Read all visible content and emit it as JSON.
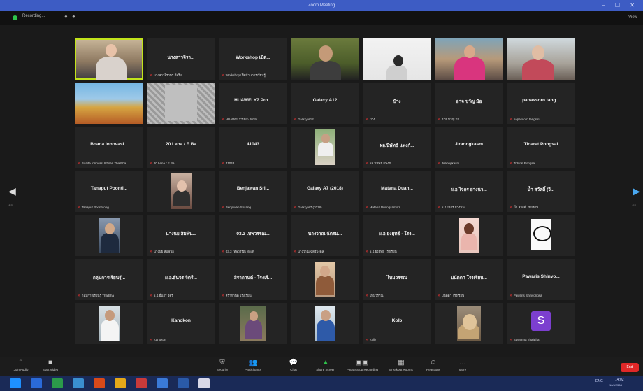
{
  "window": {
    "title": "Zoom Meeting",
    "controls": "–  ☐  ✕"
  },
  "topbar": {
    "recording_label": "Recording...",
    "dots": "● ●",
    "view_label": "View"
  },
  "nav": {
    "left_arrow": "◀",
    "right_arrow": "▶",
    "left_page": "1/3",
    "right_page": "1/3"
  },
  "tiles": [
    {
      "type": "photo",
      "name": "",
      "label": "",
      "scene": "woman-desk",
      "active": true
    },
    {
      "type": "name",
      "name": "นางสาวจิรา...",
      "label": "นางสาวจิราพร ดีจริง"
    },
    {
      "type": "name",
      "name": "Workshop เปิด...",
      "label": "Workshop เปิดบ้านการเรียนรู้"
    },
    {
      "type": "photo",
      "name": "",
      "label": "",
      "scene": "boy-green"
    },
    {
      "type": "photo",
      "name": "",
      "label": "",
      "scene": "boy-white"
    },
    {
      "type": "photo",
      "name": "",
      "label": "",
      "scene": "girl-pink"
    },
    {
      "type": "photo",
      "name": "",
      "label": "",
      "scene": "woman-room"
    },
    {
      "type": "photo",
      "name": "",
      "label": "",
      "scene": "temple"
    },
    {
      "type": "photo",
      "name": "",
      "label": "",
      "scene": "gray-pattern"
    },
    {
      "type": "name",
      "name": "HUAWEI Y7 Pro...",
      "label": "HUAWEI Y7 Pro 2019"
    },
    {
      "type": "name",
      "name": "Galaxy A12",
      "label": "Galaxy A12"
    },
    {
      "type": "name",
      "name": "ป้าง",
      "label": "ป้าง"
    },
    {
      "type": "name",
      "name": "อาจ ขวัญ ม้อ",
      "label": "อาจ ขวัญ ม้อ"
    },
    {
      "type": "name",
      "name": "papassorn tang...",
      "label": "papassorn tangsiri"
    },
    {
      "type": "name",
      "name": "Boada Innovasi...",
      "label": "Boada Innovasi Ikhsan ThaiBha"
    },
    {
      "type": "name",
      "name": "20 Lena / E.Ba",
      "label": "20 Lena / E.Ba"
    },
    {
      "type": "name",
      "name": "41043",
      "label": "41043"
    },
    {
      "type": "photo",
      "name": "",
      "label": "",
      "scene": "person-outdoor"
    },
    {
      "type": "name",
      "name": "ผอ.นิพัทธ์ แพงก์...",
      "label": "ผอ.นิพัทธ์ แพงก์"
    },
    {
      "type": "name",
      "name": "Jiraongkasm",
      "label": "Jiraongkasm"
    },
    {
      "type": "name",
      "name": "Tidarat Pongsai",
      "label": "Tidarat Pongsai"
    },
    {
      "type": "name",
      "name": "Tanaput Poonti...",
      "label": "Tanaput Poontirong"
    },
    {
      "type": "photo",
      "name": "",
      "label": "",
      "scene": "woman-portrait"
    },
    {
      "type": "name",
      "name": "Benjawan Sri...",
      "label": "Benjawan Srisang"
    },
    {
      "type": "name",
      "name": "Galaxy A7 (2018)",
      "label": "Galaxy A7 (2018)"
    },
    {
      "type": "name",
      "name": "Matana Duan...",
      "label": "Matana Duangsamorn"
    },
    {
      "type": "name",
      "name": "ผ.อ.ใจกร ยางนา...",
      "label": "ผ.อ.ใจกร ยางนาง"
    },
    {
      "type": "name",
      "name": "น้ำ สวัสดิ์ (วิ...",
      "label": "น้ำ สวัสดิ์ ไชยรัตน์"
    },
    {
      "type": "photo",
      "name": "",
      "label": "",
      "scene": "man-suit"
    },
    {
      "type": "name",
      "name": "นางนย สิมพัน...",
      "label": "นางนย สิมพันธ์"
    },
    {
      "type": "name",
      "name": "03.3 เทพวรรณ...",
      "label": "03.3 เทพวรรณ ทองดี"
    },
    {
      "type": "name",
      "name": "นางวาณ ฉัตรม...",
      "label": "นางวาณ ฉัตรมงคล"
    },
    {
      "type": "name",
      "name": "ผ.อ.ยงยุทธ์ - โรง...",
      "label": "ผ.อ.ยงยุทธ์ โรงเรียน"
    },
    {
      "type": "photo",
      "name": "",
      "label": "",
      "scene": "woman-pink"
    },
    {
      "type": "photo",
      "name": "",
      "label": "",
      "scene": "logo-nc"
    },
    {
      "type": "name",
      "name": "กลุ่มการเรียนรู้...",
      "label": "กลุ่มการเรียนรู้ ThaiBha"
    },
    {
      "type": "name",
      "name": "ผ.อ.ฮั่นจร จิตรี...",
      "label": "ผ.อ.ฮั่นจร จิตรี"
    },
    {
      "type": "name",
      "name": "สิรากานต์ - โรงเรี...",
      "label": "สิรากานต์ โรงเรียน"
    },
    {
      "type": "photo",
      "name": "",
      "label": "",
      "scene": "couple"
    },
    {
      "type": "name",
      "name": "ไหมวรรณ",
      "label": "ไหมวรรณ"
    },
    {
      "type": "name",
      "name": "ปนัดดา โรงเรียน...",
      "label": "ปนัดดา โรงเรียน"
    },
    {
      "type": "name",
      "name": "Pawaris Shinvo...",
      "label": "Pawaris Shinvongsa"
    },
    {
      "type": "photo",
      "name": "",
      "label": "",
      "scene": "man-white"
    },
    {
      "type": "name",
      "name": "Kanokon",
      "label": "Kanokon"
    },
    {
      "type": "photo",
      "name": "",
      "label": "",
      "scene": "outdoor-crowd"
    },
    {
      "type": "photo",
      "name": "",
      "label": "",
      "scene": "man-blue"
    },
    {
      "type": "name",
      "name": "Kolb",
      "label": "Kolb"
    },
    {
      "type": "photo",
      "name": "",
      "label": "",
      "scene": "dog"
    },
    {
      "type": "avatar",
      "name": "S",
      "label": "Suwanna ThaiBha",
      "avatar_color": "#7c3fcf"
    }
  ],
  "toolbar": {
    "items": [
      {
        "icon": "⌃",
        "label": "Join Audio"
      },
      {
        "icon": "■",
        "label": "Start Video"
      },
      {
        "icon": "⛨",
        "label": "Security"
      },
      {
        "icon": "👥",
        "label": "Participants"
      },
      {
        "icon": "💬",
        "label": "Chat"
      },
      {
        "icon": "▲",
        "label": "Share Screen"
      },
      {
        "icon": "▣▣",
        "label": "Pause/Stop Recording"
      },
      {
        "icon": "▦",
        "label": "Breakout Rooms"
      },
      {
        "icon": "☺",
        "label": "Reactions"
      },
      {
        "icon": "…",
        "label": "More"
      }
    ],
    "end_label": "End"
  },
  "taskbar": {
    "time": "14:02",
    "date": "16/6/2564",
    "lang": "ENG"
  },
  "colors": {
    "active_speaker": "#c2e31b",
    "end_button": "#e02828",
    "taskbar": "#1a2a57",
    "titlebar": "#3d5cc4"
  }
}
